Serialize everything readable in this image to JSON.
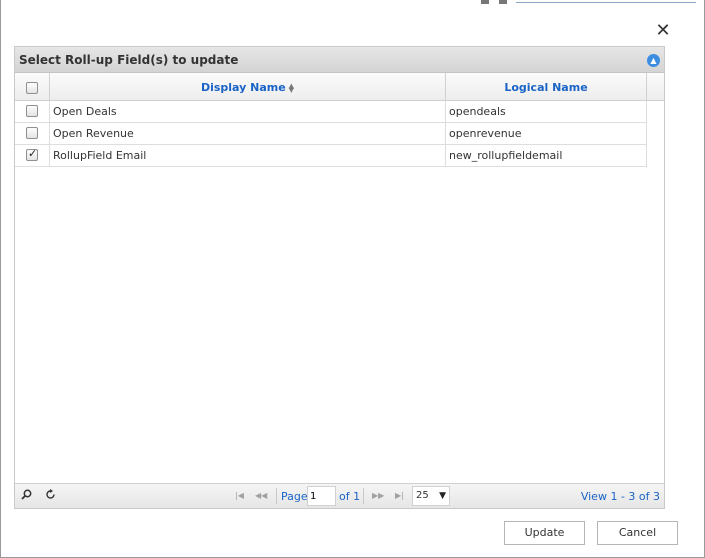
{
  "dialog": {
    "close_glyph": "✕"
  },
  "grid": {
    "title": "Select Roll-up Field(s) to update",
    "collapse_glyph": "▲",
    "columns": {
      "display_name": "Display Name",
      "logical_name": "Logical Name"
    },
    "sort_glyph": "▲▼",
    "rows": [
      {
        "display_name": "Open Deals",
        "logical_name": "opendeals",
        "checked": false
      },
      {
        "display_name": "Open Revenue",
        "logical_name": "openrevenue",
        "checked": false
      },
      {
        "display_name": "RollupField Email",
        "logical_name": "new_rollupfieldemail",
        "checked": true
      }
    ]
  },
  "footer": {
    "search_icon": "search-icon",
    "refresh_icon": "refresh-icon",
    "page_label": "Page",
    "page_value": "1",
    "of_label": "of 1",
    "rows_per_page": "25",
    "view_range": "View 1 - 3 of 3"
  },
  "buttons": {
    "update": "Update",
    "cancel": "Cancel"
  },
  "colors": {
    "accent": "#1a63c6",
    "collapse_blue": "#3d8ee0"
  }
}
